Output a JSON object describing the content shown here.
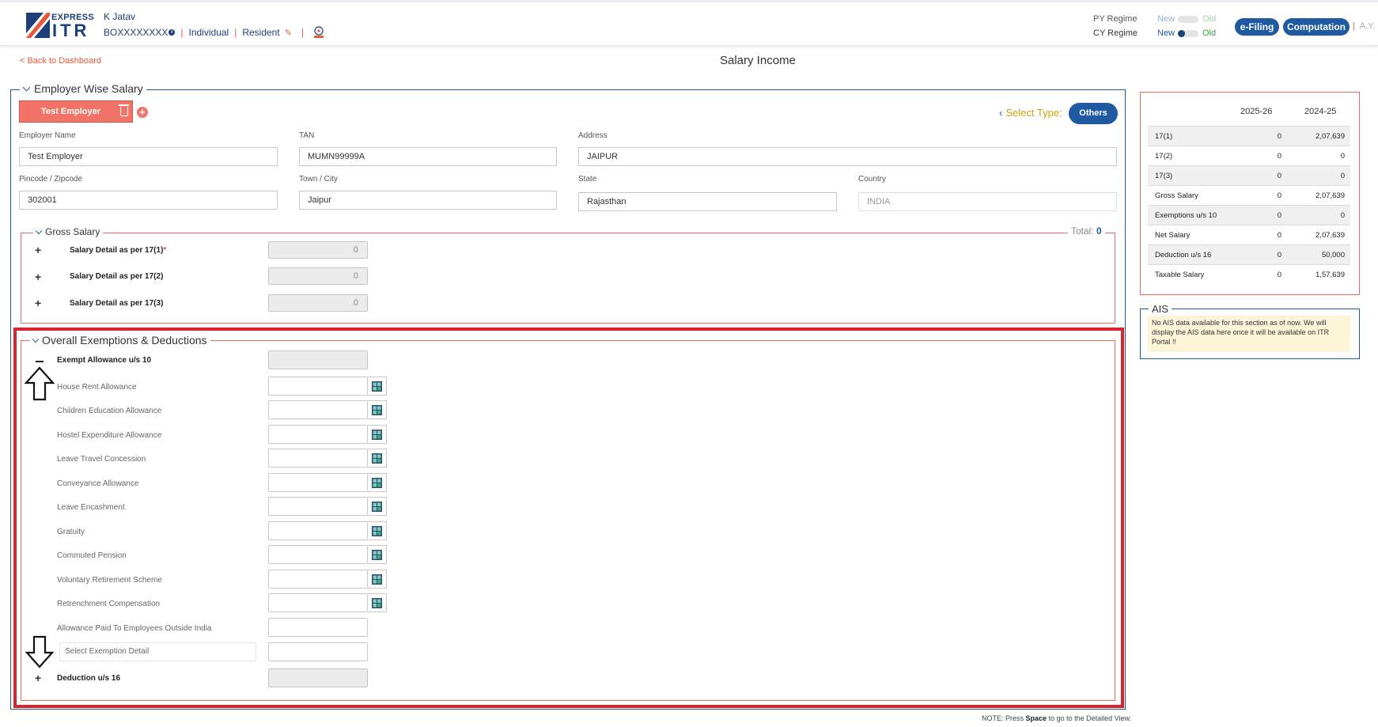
{
  "header": {
    "logo_top": "EXPRESS",
    "logo_main": "ITR",
    "user_name": "K Jatav",
    "pan": "BOXXXXXXXX",
    "status": "Individual",
    "residency": "Resident",
    "py_regime_label": "PY Regime",
    "cy_regime_label": "CY Regime",
    "new_label": "New",
    "old_label": "Old",
    "efiling_label": "e-Filing",
    "computation_label": "Computation",
    "ay_label": "A.Y."
  },
  "nav": {
    "back_label": "< Back to Dashboard",
    "page_title": "Salary Income"
  },
  "employer_section": {
    "legend": "Employer Wise Salary",
    "tab_label": "Test Employer",
    "select_type_label": "Select Type:",
    "select_type_value": "Others",
    "fields": {
      "employer_name_label": "Employer Name",
      "employer_name": "Test Employer",
      "tan_label": "TAN",
      "tan": "MUMN99999A",
      "address_label": "Address",
      "address": "JAIPUR",
      "pincode_label": "Pincode / Zipcode",
      "pincode": "302001",
      "city_label": "Town / City",
      "city": "Jaipur",
      "state_label": "State",
      "state": "Rajasthan",
      "country_label": "Country",
      "country": "INDIA"
    }
  },
  "gross_salary": {
    "legend": "Gross Salary",
    "total_label": "Total:",
    "total_value": "0",
    "rows": [
      {
        "label": "Salary Detail as per 17(1)",
        "required": "*",
        "value": "0"
      },
      {
        "label": "Salary Detail as per 17(2)",
        "value": "0"
      },
      {
        "label": "Salary Detail as per 17(3)",
        "value": "0"
      }
    ]
  },
  "exemptions": {
    "legend": "Overall Exemptions & Deductions",
    "exempt_header": "Exempt Allowance u/s 10",
    "items": [
      "House Rent Allowance",
      "Children Education Allowance",
      "Hostel Expenditure Allowance",
      "Leave Travel Concession",
      "Conveyance Allowance",
      "Leave Encashment",
      "Gratuity",
      "Commuted Pension",
      "Voluntary Retirement Scheme",
      "Retrenchment Compensation",
      "Allowance Paid To Employees Outside India"
    ],
    "select_placeholder": "Select Exemption Detail",
    "deduction_label": "Deduction u/s 16"
  },
  "note": {
    "prefix": "NOTE: Press",
    "key": "Space",
    "suffix": "to go to the Detailed View."
  },
  "summary": {
    "col1": "2025-26",
    "col2": "2024-25",
    "rows": [
      {
        "k": "17(1)",
        "v1": "0",
        "v2": "2,07,639"
      },
      {
        "k": "17(2)",
        "v1": "0",
        "v2": "0"
      },
      {
        "k": "17(3)",
        "v1": "0",
        "v2": "0"
      },
      {
        "k": "Gross Salary",
        "v1": "0",
        "v2": "2,07,639"
      },
      {
        "k": "Exemptions u/s 10",
        "v1": "0",
        "v2": "0"
      },
      {
        "k": "Net Salary",
        "v1": "0",
        "v2": "2,07,639"
      },
      {
        "k": "Deduction u/s 16",
        "v1": "0",
        "v2": "50,000"
      },
      {
        "k": "Taxable Salary",
        "v1": "0",
        "v2": "1,57,639"
      }
    ]
  },
  "ais": {
    "title": "AIS",
    "message": "No AIS data available for this section as of now. We will display the AIS data here once it will be available on ITR Portal !!"
  },
  "colors": {
    "brand_blue": "#1f5aa0",
    "accent_red": "#f27367",
    "highlight_red": "#d8242d"
  },
  "icons": {
    "edit": "pencil-icon",
    "delete": "trash-icon",
    "add": "plus-circle-icon",
    "calculator": "calculator-icon"
  }
}
